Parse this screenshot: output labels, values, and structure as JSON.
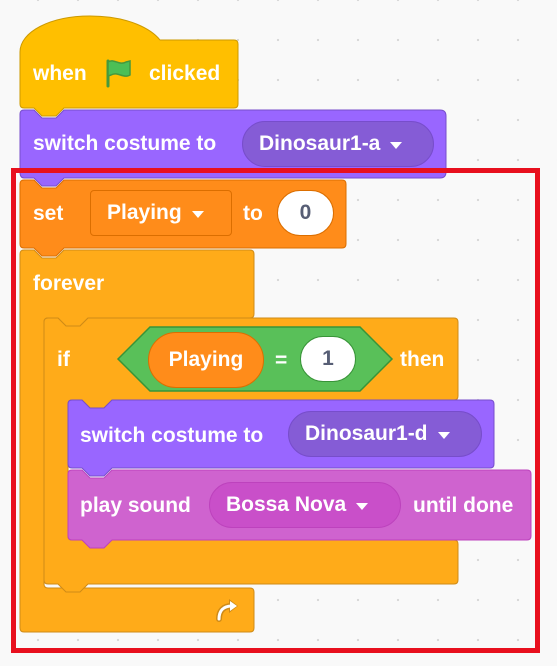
{
  "colors": {
    "events": "#ffbf00",
    "events_stroke": "#cc9900",
    "looks": "#9966ff",
    "looks_stroke": "#774dcb",
    "variables": "#ff8c1a",
    "variables_stroke": "#db6e00",
    "control": "#ffab19",
    "control_stroke": "#cf8b17",
    "operators": "#59c059",
    "operators_stroke": "#389438",
    "sound": "#cf63cf",
    "sound_stroke": "#bd42bd",
    "highlight": "#e8101e"
  },
  "script": {
    "hat": {
      "when_label": "when",
      "clicked_label": "clicked",
      "icon": "green-flag-icon"
    },
    "switch_costume_1": {
      "label": "switch costume to",
      "costume": "Dinosaur1-a"
    },
    "set_variable": {
      "set_label": "set",
      "variable": "Playing",
      "to_label": "to",
      "value": "0"
    },
    "forever": {
      "label": "forever",
      "loop_icon": "loop-arrow-icon"
    },
    "if_block": {
      "if_label": "if",
      "then_label": "then",
      "condition": {
        "left": "Playing",
        "operator": "=",
        "right": "1"
      }
    },
    "switch_costume_2": {
      "label": "switch costume to",
      "costume": "Dinosaur1-d"
    },
    "play_sound": {
      "label": "play sound",
      "sound": "Bossa Nova",
      "until_label": "until done"
    }
  }
}
